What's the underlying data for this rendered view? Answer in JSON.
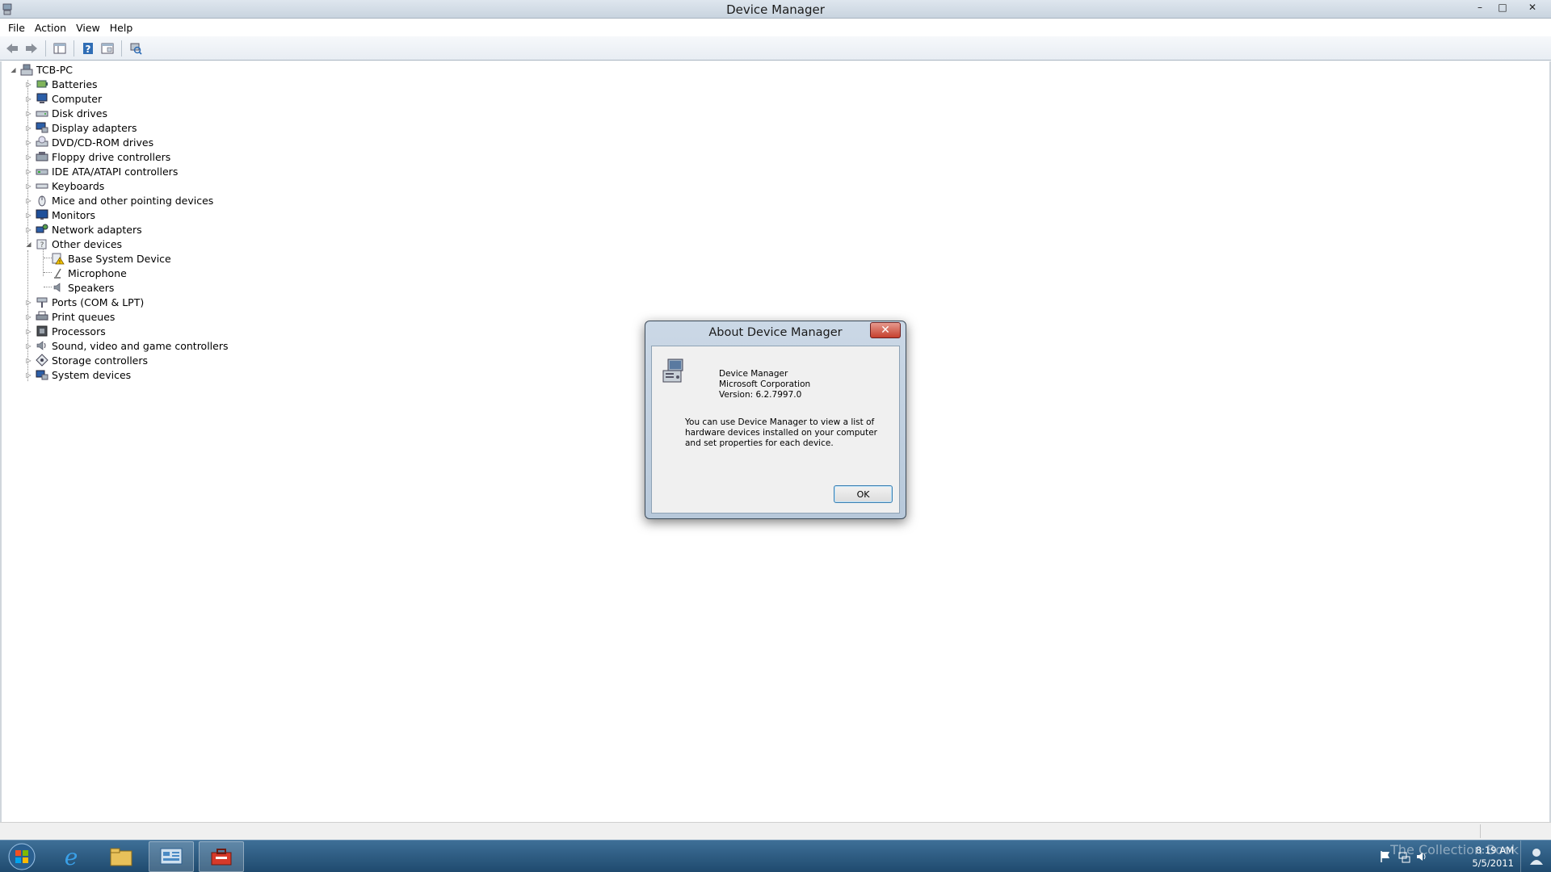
{
  "window": {
    "title": "Device Manager",
    "controls": {
      "minimize": "–",
      "maximize": "□",
      "close": "✕"
    }
  },
  "menu": [
    "File",
    "Action",
    "View",
    "Help"
  ],
  "toolbar": {
    "buttons": [
      "back-icon",
      "forward-icon",
      "show-hide-console-tree-icon",
      "help-icon",
      "properties-icon",
      "scan-hardware-icon"
    ]
  },
  "tree": {
    "root": "TCB-PC",
    "categories": [
      {
        "label": "Batteries",
        "icon": "battery-icon"
      },
      {
        "label": "Computer",
        "icon": "computer-icon"
      },
      {
        "label": "Disk drives",
        "icon": "disk-drive-icon"
      },
      {
        "label": "Display adapters",
        "icon": "display-adapter-icon"
      },
      {
        "label": "DVD/CD-ROM drives",
        "icon": "dvd-drive-icon"
      },
      {
        "label": "Floppy drive controllers",
        "icon": "floppy-controller-icon"
      },
      {
        "label": "IDE ATA/ATAPI controllers",
        "icon": "ide-controller-icon"
      },
      {
        "label": "Keyboards",
        "icon": "keyboard-icon"
      },
      {
        "label": "Mice and other pointing devices",
        "icon": "mouse-icon"
      },
      {
        "label": "Monitors",
        "icon": "monitor-icon"
      },
      {
        "label": "Network adapters",
        "icon": "network-adapter-icon"
      },
      {
        "label": "Other devices",
        "icon": "other-devices-icon",
        "expanded": true,
        "children": [
          "Base System Device",
          "Microphone",
          "Speakers"
        ]
      },
      {
        "label": "Ports (COM & LPT)",
        "icon": "port-icon"
      },
      {
        "label": "Print queues",
        "icon": "printer-icon"
      },
      {
        "label": "Processors",
        "icon": "processor-icon"
      },
      {
        "label": "Sound, video and game controllers",
        "icon": "sound-icon"
      },
      {
        "label": "Storage controllers",
        "icon": "storage-controller-icon"
      },
      {
        "label": "System devices",
        "icon": "system-device-icon"
      }
    ]
  },
  "dialog": {
    "title": "About Device Manager",
    "close": "✕",
    "product": "Device Manager",
    "company": "Microsoft Corporation",
    "version": "Version: 6.2.7997.0",
    "description": "You can use Device Manager to view a list of hardware devices installed on your computer and set properties for each device.",
    "ok": "OK"
  },
  "taskbar": {
    "apps": [
      "internet-explorer-icon",
      "file-explorer-icon",
      "control-panel-icon",
      "device-manager-icon"
    ],
    "clock_time": "8:19 AM",
    "clock_date": "5/5/2011",
    "watermark": "The Collection Book"
  }
}
